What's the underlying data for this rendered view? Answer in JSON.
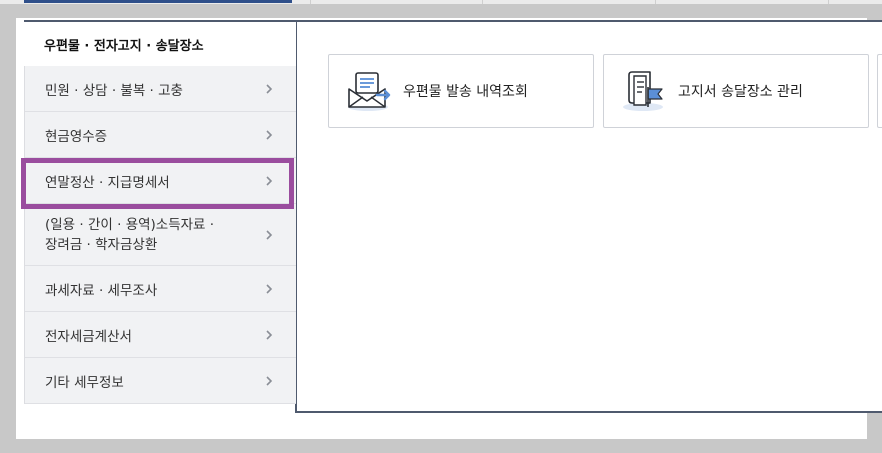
{
  "sidebar": {
    "title": "우편물 · 전자고지 · 송달장소",
    "items": [
      {
        "label": "민원 · 상담 · 불복 · 고충"
      },
      {
        "label": "현금영수증"
      },
      {
        "label": "연말정산 · 지급명세서"
      },
      {
        "label": "(일용 · 간이 · 용역)소득자료 · \n장려금 · 학자금상환"
      },
      {
        "label": "과세자료 · 세무조사"
      },
      {
        "label": "전자세금계산서"
      },
      {
        "label": "기타 세무정보"
      }
    ]
  },
  "main": {
    "cards": [
      {
        "label": "우편물 발송 내역조회",
        "icon": "mail-envelope-icon"
      },
      {
        "label": "고지서 송달장소 관리",
        "icon": "document-flag-icon"
      }
    ]
  },
  "colors": {
    "highlight": "#9a4d9e",
    "border_dark": "#4f5a6e",
    "sidebar_bg": "#f1f2f4",
    "icon_blue": "#5b8fd6"
  }
}
